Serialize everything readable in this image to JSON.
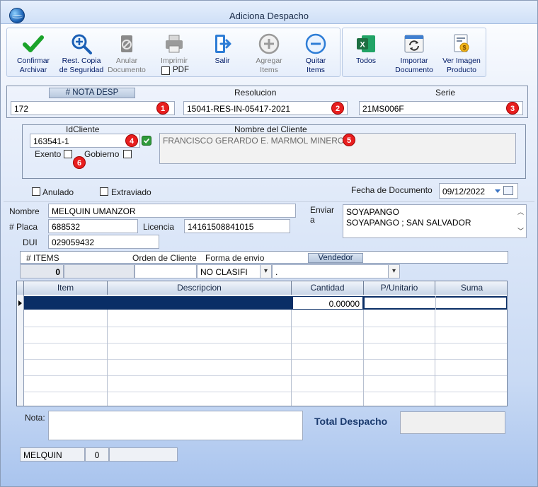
{
  "window": {
    "title": "Adiciona Despacho"
  },
  "toolbar": {
    "confirmar": "Confirmar\nArchivar",
    "rest_copia": "Rest. Copia\nde Seguridad",
    "anular": "Anular\nDocumento",
    "imprimir": "Imprimir",
    "pdf": "PDF",
    "salir": "Salir",
    "agregar": "Agregar\nItems",
    "quitar": "Quitar\nItems",
    "todos": "Todos",
    "importar": "Importar\nDocumento",
    "ver_imagen": "Ver Imagen\nProducto",
    "icon_colors": {
      "confirm": "#1aa32a",
      "exit": "#2e7dd6",
      "excel": "#1d6f42"
    }
  },
  "header": {
    "nota_label": "# NOTA DESP",
    "nota_value": "172",
    "resolucion_label": "Resolucion",
    "resolucion_value": "15041-RES-IN-05417-2021",
    "serie_label": "Serie",
    "serie_value": "21MS006F",
    "badges": [
      "1",
      "2",
      "3",
      "4",
      "5",
      "6"
    ]
  },
  "client": {
    "id_label": "IdCliente",
    "id_value": "163541-1",
    "name_label": "Nombre del Cliente",
    "name_value": "FRANCISCO GERARDO E. MARMOL MINERO",
    "exento_label": "Exento",
    "gobierno_label": "Gobierno"
  },
  "status": {
    "anulado_label": "Anulado",
    "extraviado_label": "Extraviado",
    "fecha_label": "Fecha de Documento",
    "fecha_value": "09/12/2022"
  },
  "driver": {
    "nombre_label": "Nombre",
    "nombre_value": "MELQUIN UMANZOR",
    "placa_label": "# Placa",
    "placa_value": "688532",
    "licencia_label": "Licencia",
    "licencia_value": "14161508841015",
    "dui_label": "DUI",
    "dui_value": "029059432",
    "enviar_label": "Enviar\na",
    "enviar_lines": [
      "SOYAPANGO",
      "SOYAPANGO ; SAN SALVADOR"
    ]
  },
  "items_bar": {
    "items_label": "# ITEMS",
    "items_value": "0",
    "orden_label": "Orden de Cliente",
    "forma_label": "Forma de envio",
    "forma_value": "NO CLASIFI",
    "vendedor_label": "Vendedor",
    "vendedor_value": "."
  },
  "grid": {
    "columns": [
      "Item",
      "Descripcion",
      "Cantidad",
      "P/Unitario",
      "Suma"
    ],
    "first_row_cantidad": "0.00000"
  },
  "footer": {
    "nota_label": "Nota:",
    "total_label": "Total Despacho",
    "user": "MELQUIN",
    "count": "0"
  }
}
